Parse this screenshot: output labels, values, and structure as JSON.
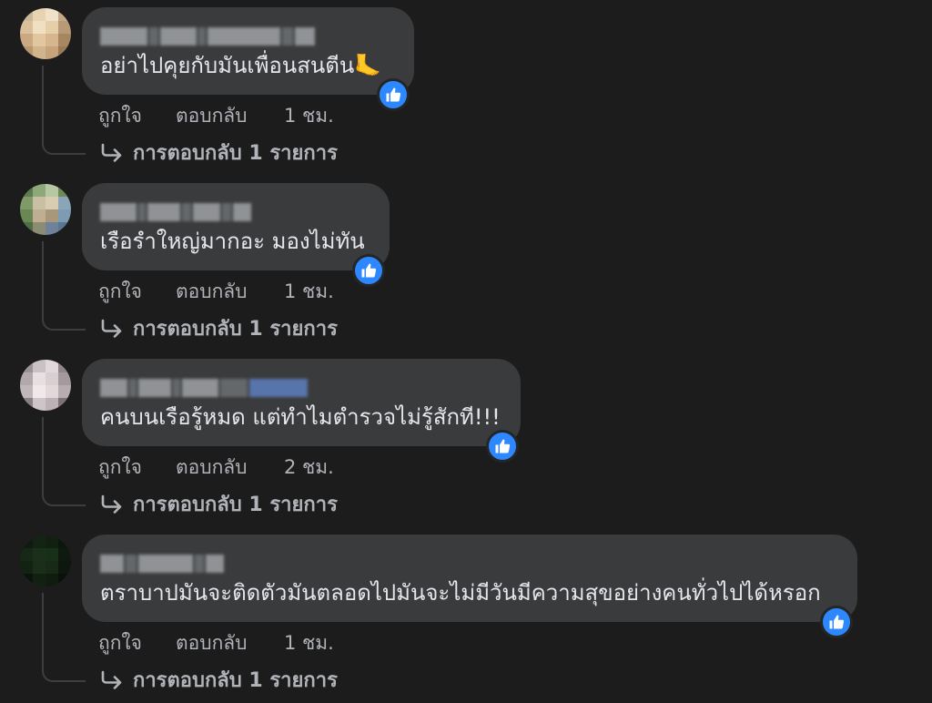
{
  "comments": [
    {
      "text": "อย่าไปคุยกับมันเพื่อนสนตีน🦶",
      "like_label": "ถูกใจ",
      "reply_label": "ตอบกลับ",
      "time": "1 ชม.",
      "replies_label": "การตอบกลับ 1 รายการ"
    },
    {
      "text": "เรือรำใหญ่มากอะ มองไม่ทัน",
      "like_label": "ถูกใจ",
      "reply_label": "ตอบกลับ",
      "time": "1 ชม.",
      "replies_label": "การตอบกลับ 1 รายการ"
    },
    {
      "text": "คนบนเรือรู้หมด แต่ทำไมตำรวจไม่รู้สักที!!!",
      "like_label": "ถูกใจ",
      "reply_label": "ตอบกลับ",
      "time": "2 ชม.",
      "replies_label": "การตอบกลับ 1 รายการ"
    },
    {
      "text": "ตราบาปมันจะติดตัวมันตลอดไปมันจะไม่มีวันมีความสุขอย่างคนทั่วไปได้หรอก",
      "like_label": "ถูกใจ",
      "reply_label": "ตอบกลับ",
      "time": "1 ชม.",
      "replies_label": "การตอบกลับ 1 รายการ"
    }
  ],
  "colors": {
    "background": "#1c1c1d",
    "bubble": "#3a3b3c",
    "text": "#e4e6eb",
    "meta_text": "#b0b3b8",
    "like_badge": "#2d88ff"
  },
  "icons": {
    "like_badge": "thumbs-up-icon",
    "reply_arrow": "reply-arrow-icon"
  }
}
